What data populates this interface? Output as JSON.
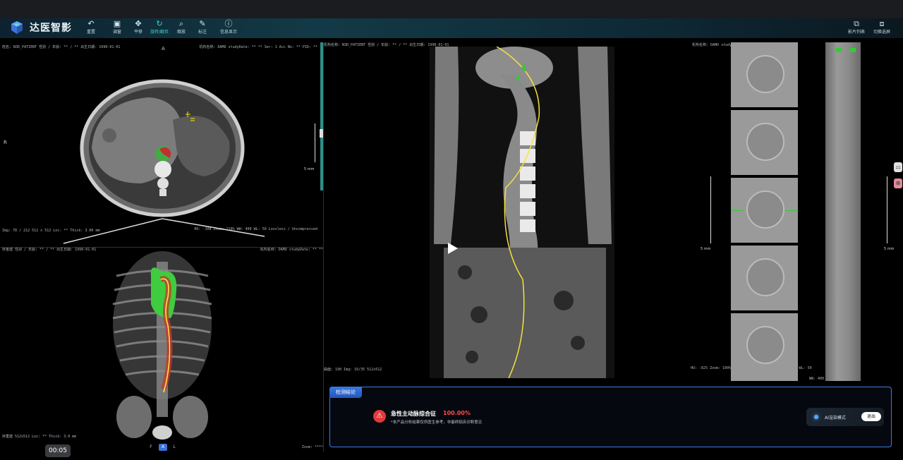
{
  "app": {
    "title": "达医智影"
  },
  "toolbar": {
    "tools": [
      {
        "label": "重置",
        "icon": "undo-icon"
      },
      {
        "label": "调窗",
        "icon": "window-icon"
      },
      {
        "label": "平移",
        "icon": "move-icon"
      },
      {
        "label": "旋转/翻页",
        "icon": "rotate-icon"
      },
      {
        "label": "缩放",
        "icon": "zoom-icon"
      },
      {
        "label": "标注",
        "icon": "annotate-icon"
      },
      {
        "label": "信息显示",
        "icon": "info-icon"
      }
    ],
    "right_tools": [
      {
        "label": "影片列表",
        "icon": "film-list-icon"
      },
      {
        "label": "切换选屏",
        "icon": "switch-screen-icon"
      }
    ],
    "active_tool_index": 3,
    "accent": "#3fd0c8"
  },
  "axial": {
    "orient_top": "A",
    "orient_left": "R",
    "info_left": "姓名: N3D_PATIENT\n性别 / 年龄: ** / **\n出生日期: 1990-01-01",
    "info_right": "机构名称: DAMO\nstudyDate: ** **\nSer: 1\nAcc No: **\nPID: **",
    "bottom_left": "Img: 78 / 212\n512 x 512\nLoc: ** Thick: 3.00 mm",
    "bottom_right": "HU: -108\nZoom: 110%\nWW: 400 WL: 50\nLossless / Uncompressed",
    "scale": "5 mm"
  },
  "volume": {
    "info_left": "序重建\n性别 / 年龄: ** / **\n出生日期: 1990-01-01",
    "info_right": "机构名称: DAMO\nstudyDate: ** **",
    "bottom_left": "序重建\n512x512\nLoc: ** Thick: 3.0 mm",
    "bottom_right": "Zoom: ****",
    "orient_buttons": [
      "F",
      "A",
      "L"
    ],
    "selected_orient": "A"
  },
  "sagittal": {
    "info_left": "机构名称: N3D_PATIENT\n性别 / 年龄: ** / **\n出生日期: 1990-01-01",
    "bottom_left": "曲面: 190\nImg: 16/35\n512x512"
  },
  "cross": {
    "info_left": "机构名称: DAMO\nstudyDate: ** **",
    "bottom_right": "HU: -825\nZoom: 100% HU: 100\nWW: 400 WL: 50 WW: 400 WL: 50",
    "scale_left": "5 mm",
    "scale_right": "5 mm",
    "bottom_far": "WW: 400"
  },
  "result": {
    "tab": "检测结论",
    "diagnosis": "急性主动脉综合征",
    "score": "100.00%",
    "note": "*本产品分析结果仅供医生参考，非最终临床诊断意见",
    "ai_mode": "AI渲染模式",
    "exit": "退出",
    "danger": "#e23a3a"
  },
  "timer": "00:05"
}
